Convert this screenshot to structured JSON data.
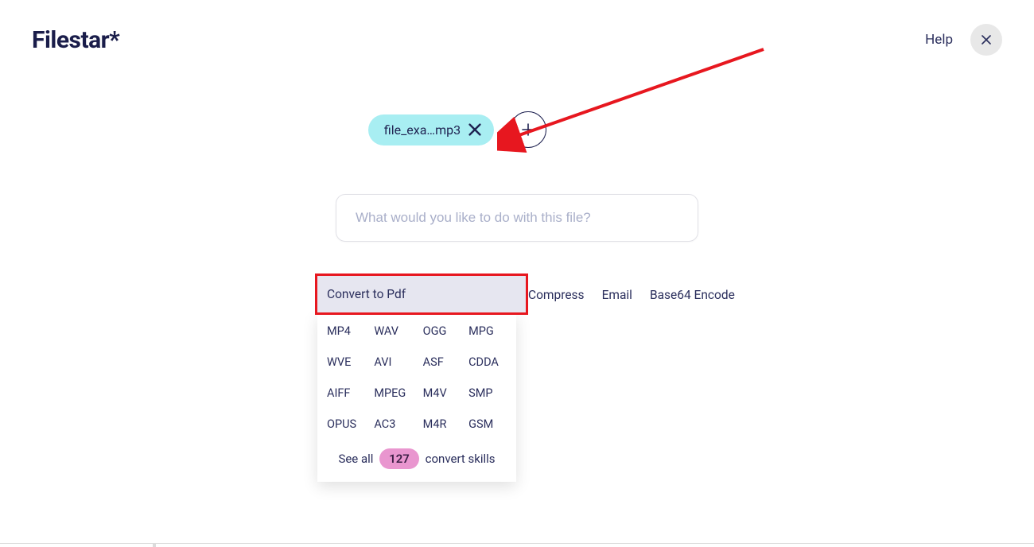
{
  "header": {
    "logo": "Filestar*",
    "help": "Help"
  },
  "file_chip": {
    "label": "file_exa…mp3"
  },
  "search": {
    "placeholder": "What would you like to do with this file?"
  },
  "actions": {
    "primary": "Convert to Pdf",
    "others": [
      "Compress",
      "Email",
      "Base64 Encode"
    ]
  },
  "formats": {
    "rows": [
      [
        "MP4",
        "WAV",
        "OGG",
        "MPG"
      ],
      [
        "WVE",
        "AVI",
        "ASF",
        "CDDA"
      ],
      [
        "AIFF",
        "MPEG",
        "M4V",
        "SMP"
      ],
      [
        "OPUS",
        "AC3",
        "M4R",
        "GSM"
      ]
    ],
    "see_all_prefix": "See all",
    "count": "127",
    "see_all_suffix": "convert skills"
  }
}
